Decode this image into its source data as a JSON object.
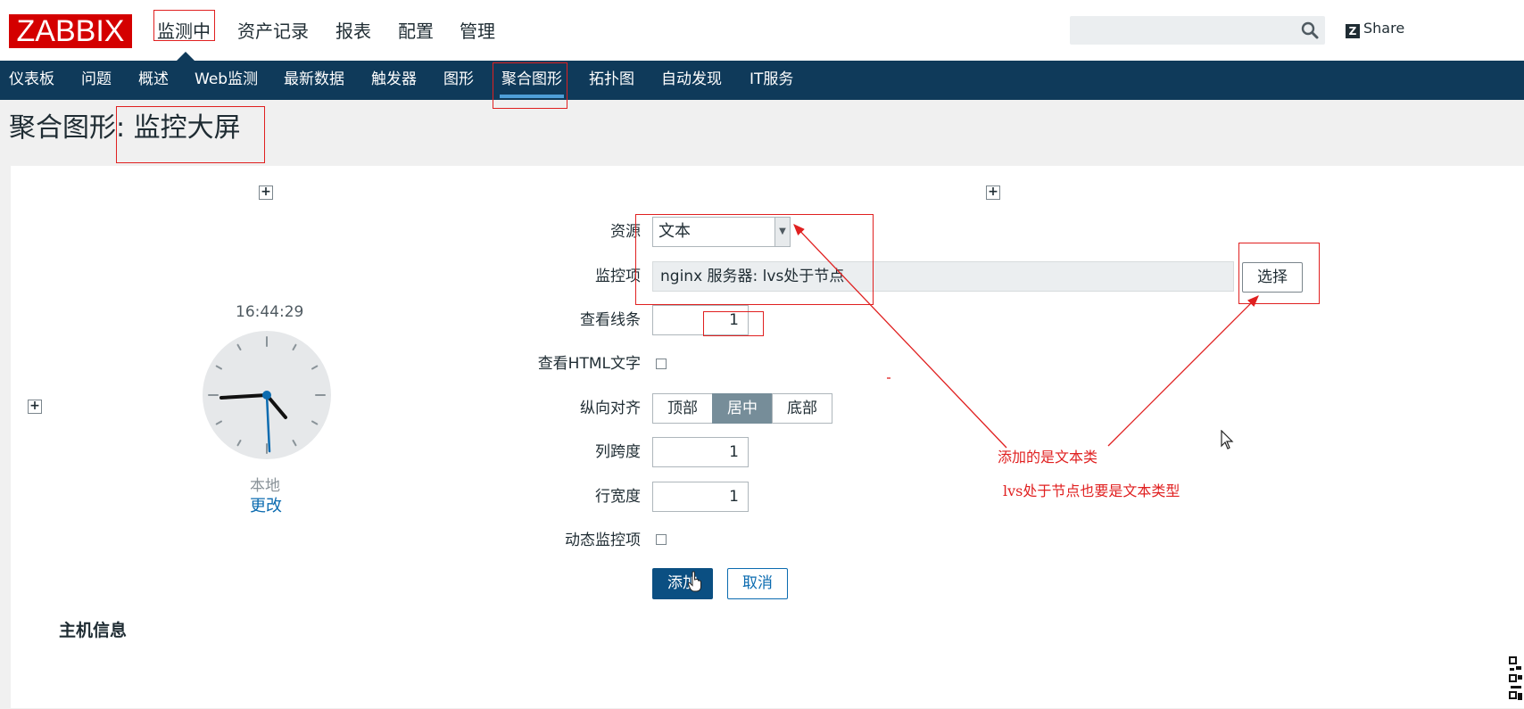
{
  "header": {
    "logo": "ZABBIX",
    "main_nav": [
      "监测中",
      "资产记录",
      "报表",
      "配置",
      "管理"
    ],
    "search_placeholder": "",
    "share_label": "Share",
    "share_glyph": "Z"
  },
  "sub_nav": [
    "仪表板",
    "问题",
    "概述",
    "Web监测",
    "最新数据",
    "触发器",
    "图形",
    "聚合图形",
    "拓扑图",
    "自动发现",
    "IT服务"
  ],
  "page": {
    "title": "聚合图形: 监控大屏"
  },
  "clock": {
    "time": "16:44:29",
    "zone": "本地",
    "change": "更改"
  },
  "host_info": "主机信息",
  "form": {
    "labels": {
      "resource": "资源",
      "item": "监控项",
      "show_lines": "查看线条",
      "show_html": "查看HTML文字",
      "valign": "纵向对齐",
      "colspan": "列跨度",
      "rowspan": "行宽度",
      "dynamic": "动态监控项"
    },
    "resource_value": "文本",
    "item_value": "nginx 服务器: lvs处于节点",
    "select_button": "选择",
    "show_lines_value": "1",
    "valign_options": [
      "顶部",
      "居中",
      "底部"
    ],
    "valign_selected": "居中",
    "colspan_value": "1",
    "rowspan_value": "1",
    "add_button": "添加",
    "cancel_button": "取消"
  },
  "annotations": {
    "note1": "添加的是文本类",
    "note2": "lvs处于节点也要是文本类型",
    "color": "#e02020"
  },
  "colors": {
    "brand_red": "#d40000",
    "subnav_bg": "#0f3a5a",
    "primary_button": "#0b4f82",
    "link": "#0b6bb0"
  }
}
